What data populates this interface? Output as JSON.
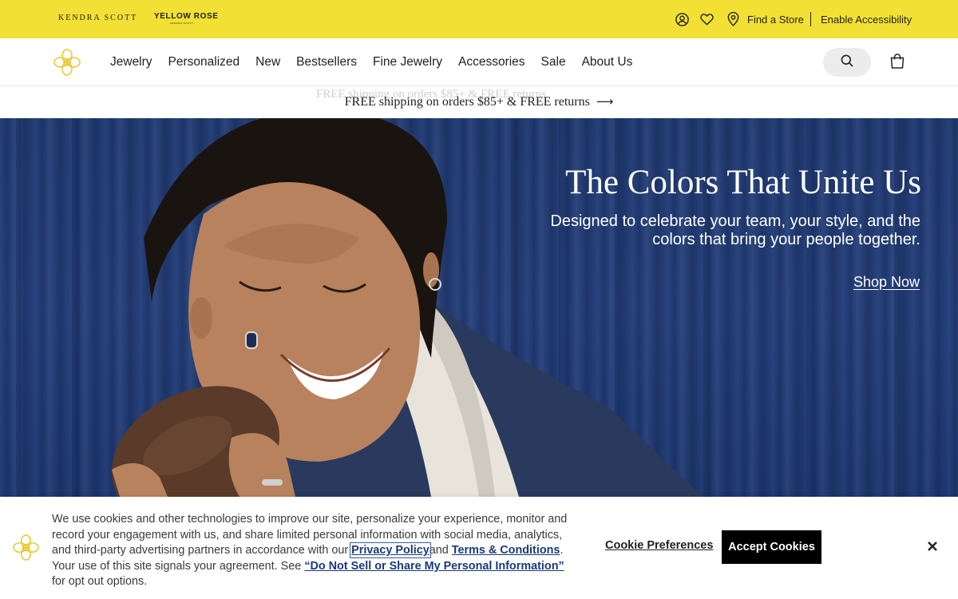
{
  "topbar": {
    "brand_primary": "KENDRA SCOTT",
    "brand_secondary": "YELLOW ROSE",
    "brand_secondary_sub": "KENDRA SCOTT",
    "find_store": "Find a Store",
    "accessibility": "Enable Accessibility",
    "icons": [
      "account-icon",
      "heart-icon",
      "location-pin-icon"
    ],
    "background": "#f2e034"
  },
  "nav": {
    "items": [
      "Jewelry",
      "Personalized",
      "New",
      "Bestsellers",
      "Fine Jewelry",
      "Accessories",
      "Sale",
      "About Us"
    ],
    "icons": [
      "search-icon",
      "shopping-bag-icon"
    ]
  },
  "promo": {
    "text": "FREE shipping on orders $85+ & FREE returns",
    "arrow": "⟶"
  },
  "hero": {
    "title": "The Colors That Unite Us",
    "subtitle": "Designed to celebrate your team, your style, and the colors that bring your people together.",
    "cta": "Shop Now",
    "background": "#223d79"
  },
  "cookie": {
    "text_1": "We use cookies and other technologies to improve our site, personalize your experience, monitor and record your engagement with us, and share limited personal information with social media, analytics, and third-party advertising partners in accordance with our ",
    "privacy_link": "Privacy Policy",
    "text_2": "and ",
    "terms_link": "Terms & Conditions",
    "text_3": ". Your use of this site signals your agreement. See ",
    "do_not_sell_link": "“Do Not Sell or Share My Personal Information”",
    "text_4": " for opt out options.",
    "preferences": "Cookie Preferences",
    "accept": "Accept Cookies"
  }
}
